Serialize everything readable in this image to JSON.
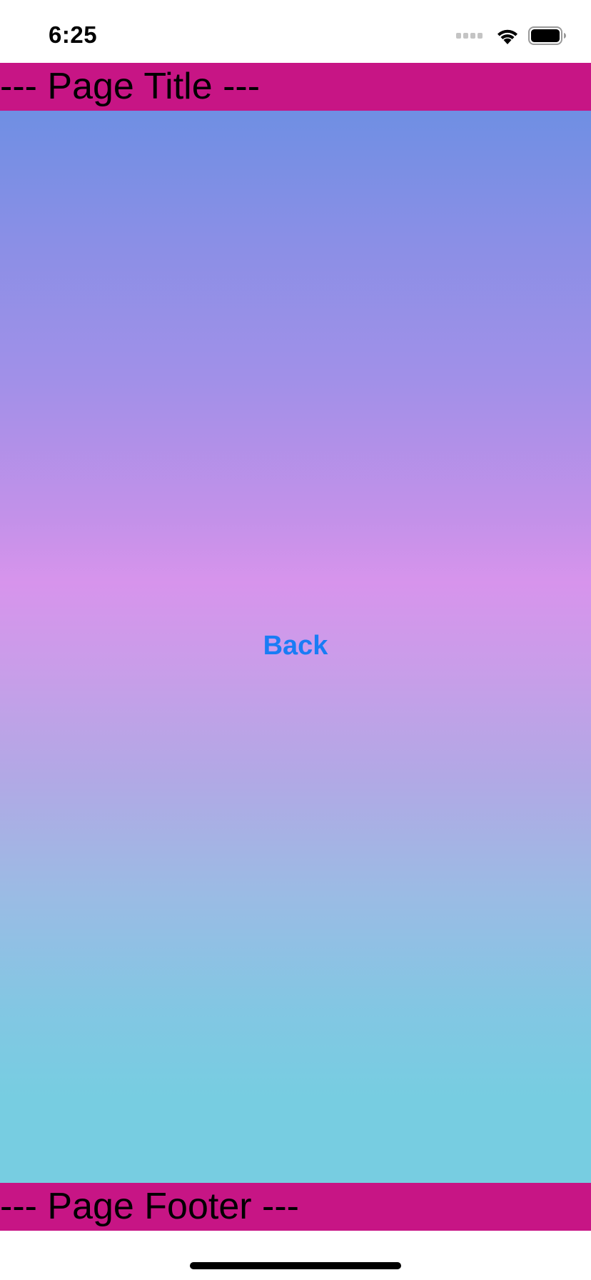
{
  "status_bar": {
    "time": "6:25",
    "icons": [
      "signal-icon",
      "wifi-icon",
      "battery-icon"
    ]
  },
  "header": {
    "title": "--- Page Title ---",
    "background": "#c71585"
  },
  "content": {
    "back_label": "Back",
    "back_color": "#1a7cf5",
    "gradient_colors": [
      "#6f8fe3",
      "#d794ec",
      "#77cde1"
    ]
  },
  "footer": {
    "title": "--- Page Footer ---",
    "background": "#c71585"
  }
}
